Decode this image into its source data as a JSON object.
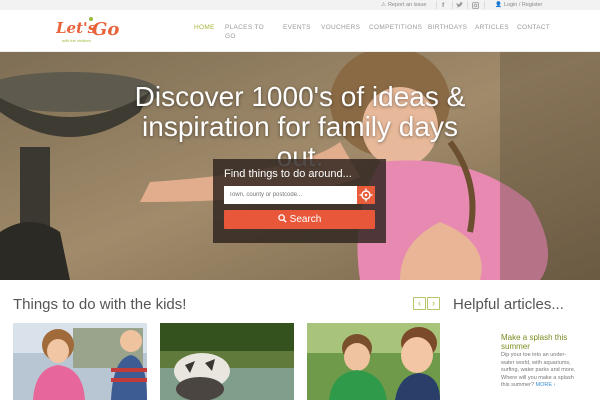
{
  "utility": {
    "report_label": "Report an issue",
    "login_label": "Login / Register",
    "social": [
      "facebook-icon",
      "twitter-icon",
      "instagram-icon"
    ]
  },
  "logo": {
    "text": "Let's Go",
    "tagline": "with the children"
  },
  "nav": {
    "home": "HOME",
    "places_line1": "PLACES TO",
    "places_line2": "GO",
    "events": "EVENTS",
    "vouchers": "VOUCHERS",
    "competitions": "COMPETITIONS",
    "birthdays": "BIRTHDAYS",
    "articles": "ARTICLES",
    "contact": "CONTACT"
  },
  "hero": {
    "title_line1": "Discover 1000's of ideas &",
    "title_line2": "inspiration for family days",
    "title_line3": "out."
  },
  "finder": {
    "title": "Find things to do around...",
    "placeholder": "Town, county or postcode...",
    "search_label": "Search"
  },
  "kids": {
    "heading": "Things to do with the kids!",
    "prev": "‹",
    "next": "›"
  },
  "articles": {
    "heading": "Helpful articles...",
    "item_title_1": "Make a splash this",
    "item_title_2": "summer",
    "item_body_1": "Dip your toe into an under-",
    "item_body_2": "water world, with aquariums,",
    "item_body_3": "surfing, water parks and more.",
    "item_body_4": "Where will you make a splash",
    "item_body_5": "this summer?",
    "more": "MORE ›"
  },
  "colors": {
    "accent": "#a9b53c",
    "search_orange": "#e8573a",
    "logo_orange": "#e8623a",
    "logo_green": "#9bb83a",
    "article_title": "#7a8c22",
    "link_blue": "#3a8ccc"
  }
}
